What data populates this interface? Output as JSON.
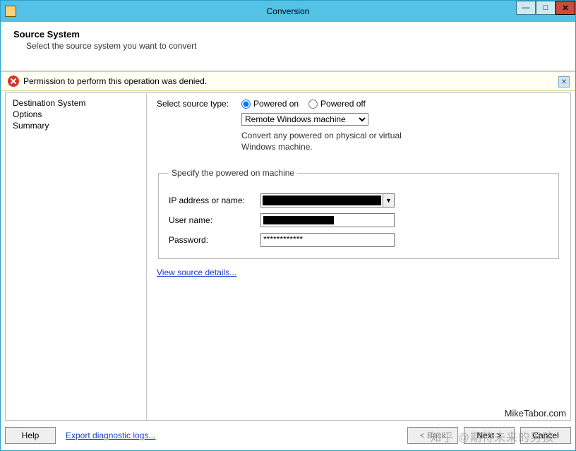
{
  "window": {
    "title": "Conversion"
  },
  "header": {
    "title": "Source System",
    "subtitle": "Select the source system you want to convert"
  },
  "notification": {
    "message": "Permission to perform this operation was denied."
  },
  "steps": {
    "items": [
      "Destination System",
      "Options",
      "Summary"
    ]
  },
  "form": {
    "source_type_label": "Select source type:",
    "radio_on": "Powered on",
    "radio_off": "Powered off",
    "radio_selected": "on",
    "source_type_dropdown": "Remote Windows machine",
    "hint": "Convert any powered on physical or virtual Windows machine.",
    "fieldset_legend": "Specify the powered on machine",
    "ip_label": "IP address or name:",
    "ip_value": "██████",
    "user_label": "User name:",
    "user_value": "██████",
    "password_label": "Password:",
    "password_value": "************",
    "view_details": "View source details..."
  },
  "watermark": "MikeTabor.com",
  "buttons": {
    "help": "Help",
    "export_logs": "Export diagnostic logs...",
    "back": "< Back",
    "next": "Next >",
    "cancel": "Cancel"
  },
  "overlay": "知乎 @期待未来的男孩"
}
